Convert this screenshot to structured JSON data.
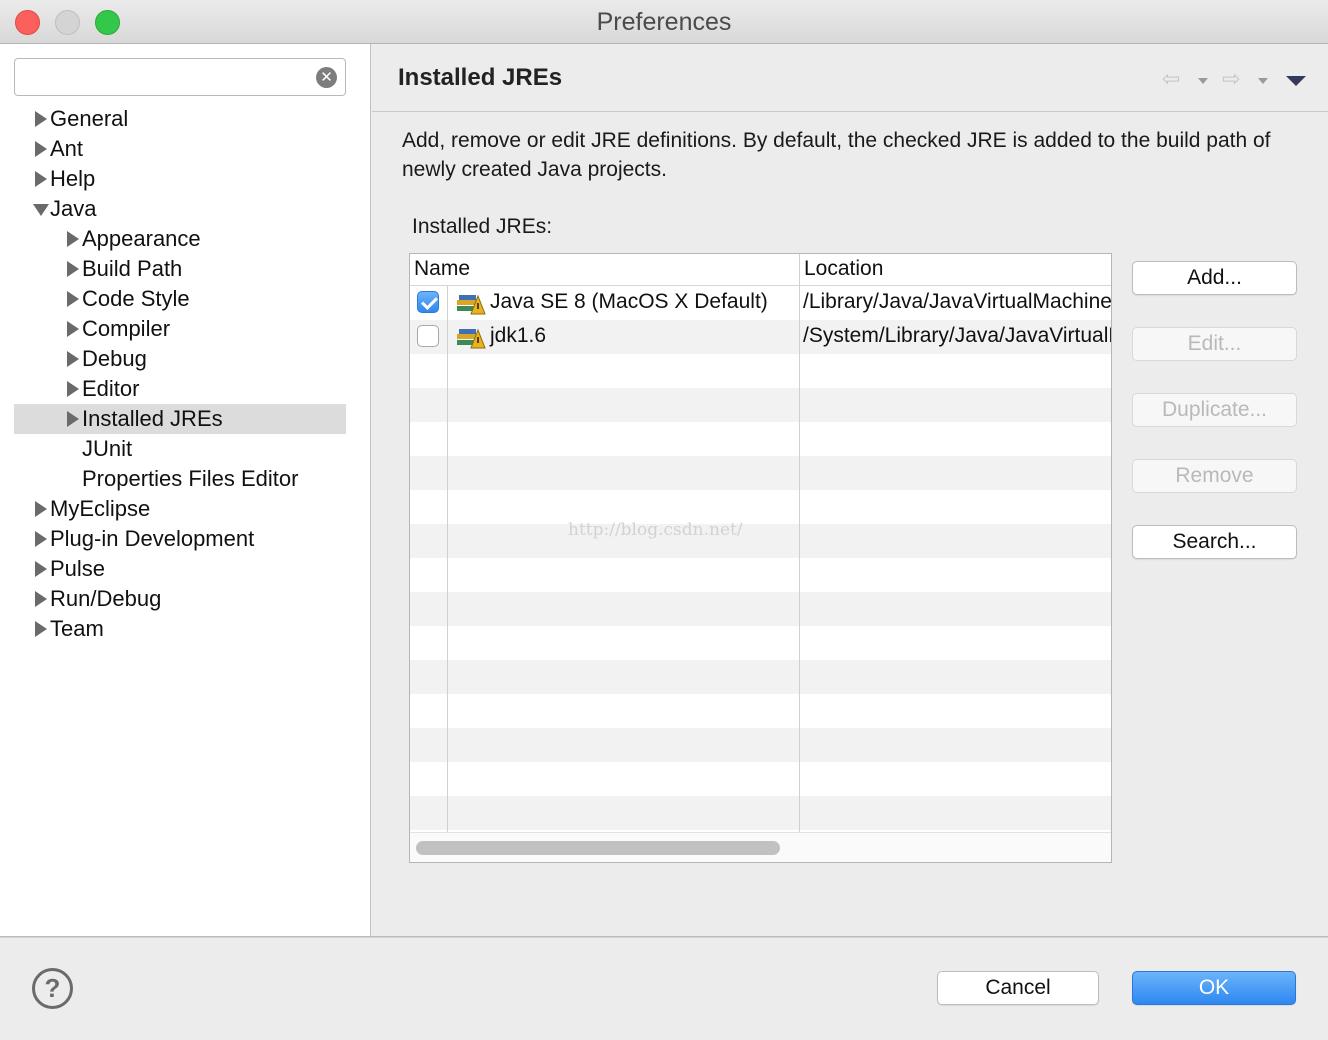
{
  "window": {
    "title": "Preferences"
  },
  "filter": {
    "value": "",
    "placeholder": ""
  },
  "tree": [
    {
      "label": "General",
      "level": 0,
      "twisty": "right"
    },
    {
      "label": "Ant",
      "level": 0,
      "twisty": "right"
    },
    {
      "label": "Help",
      "level": 0,
      "twisty": "right"
    },
    {
      "label": "Java",
      "level": 0,
      "twisty": "down"
    },
    {
      "label": "Appearance",
      "level": 1,
      "twisty": "right"
    },
    {
      "label": "Build Path",
      "level": 1,
      "twisty": "right"
    },
    {
      "label": "Code Style",
      "level": 1,
      "twisty": "right"
    },
    {
      "label": "Compiler",
      "level": 1,
      "twisty": "right"
    },
    {
      "label": "Debug",
      "level": 1,
      "twisty": "right"
    },
    {
      "label": "Editor",
      "level": 1,
      "twisty": "right"
    },
    {
      "label": "Installed JREs",
      "level": 1,
      "twisty": "right",
      "selected": true
    },
    {
      "label": "JUnit",
      "level": 1,
      "twisty": "none"
    },
    {
      "label": "Properties Files Editor",
      "level": 1,
      "twisty": "none"
    },
    {
      "label": "MyEclipse",
      "level": 0,
      "twisty": "right"
    },
    {
      "label": "Plug-in Development",
      "level": 0,
      "twisty": "right"
    },
    {
      "label": "Pulse",
      "level": 0,
      "twisty": "right"
    },
    {
      "label": "Run/Debug",
      "level": 0,
      "twisty": "right"
    },
    {
      "label": "Team",
      "level": 0,
      "twisty": "right"
    }
  ],
  "page": {
    "title": "Installed JREs",
    "description": "Add, remove or edit JRE definitions. By default, the checked JRE is added to the build path of newly created Java projects.",
    "table_title": "Installed JREs:"
  },
  "table": {
    "columns": [
      "Name",
      "Location"
    ],
    "rows": [
      {
        "checked": true,
        "name": "Java SE 8 (MacOS X Default)",
        "location": "/Library/Java/JavaVirtualMachines/"
      },
      {
        "checked": false,
        "name": "jdk1.6",
        "location": "/System/Library/Java/JavaVirtualMachines/"
      }
    ],
    "empty_rows": 14
  },
  "side_buttons": [
    {
      "label": "Add...",
      "enabled": true
    },
    {
      "label": "Edit...",
      "enabled": false
    },
    {
      "label": "Duplicate...",
      "enabled": false
    },
    {
      "label": "Remove",
      "enabled": false
    },
    {
      "label": "Search...",
      "enabled": true
    }
  ],
  "watermark": "http://blog.csdn.net/",
  "footer": {
    "cancel_label": "Cancel",
    "ok_label": "OK",
    "help_label": "?"
  },
  "icons": {
    "clear": "clear-search-icon",
    "back": "back-arrow-icon",
    "forward": "forward-arrow-icon",
    "view_menu": "view-menu-icon",
    "jre": "jre-library-icon",
    "help": "help-icon"
  },
  "colors": {
    "accent": "#2e87f1",
    "selection": "#dcdcdc"
  }
}
